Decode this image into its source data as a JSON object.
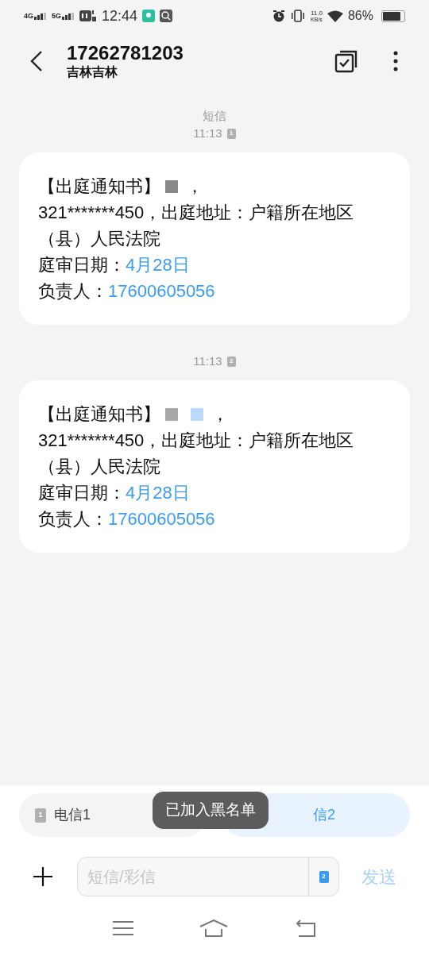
{
  "status_bar": {
    "network_1": "4G",
    "network_2": "5G",
    "time": "12:44",
    "speed": "11.0",
    "speed_unit": "KB/s",
    "battery": "86%"
  },
  "header": {
    "title": "17262781203",
    "subtitle": "吉林吉林"
  },
  "conversation": [
    {
      "kind": "label",
      "text": "短信"
    },
    {
      "kind": "time",
      "text": "11:13",
      "sim": "1"
    },
    {
      "kind": "message",
      "prefix": "【出庭通知书】",
      "redactions": [
        {
          "color": "#888888"
        }
      ],
      "comma": "，",
      "body": "321*******450，出庭地址：户籍所在地区（县）人民法院",
      "lines": [
        {
          "label": "庭审日期：",
          "link": "4月28日"
        },
        {
          "label": "负责人：",
          "link": "17600605056"
        }
      ]
    },
    {
      "kind": "time",
      "text": "11:13",
      "sim": "2"
    },
    {
      "kind": "message",
      "prefix": "【出庭通知书】",
      "redactions": [
        {
          "color": "#a8a8a8"
        },
        {
          "color": "#bcd9fb"
        }
      ],
      "comma": "，",
      "body": "321*******450，出庭地址：户籍所在地区（县）人民法院",
      "lines": [
        {
          "label": "庭审日期：",
          "link": "4月28日"
        },
        {
          "label": "负责人：",
          "link": "17600605056"
        }
      ]
    }
  ],
  "sim_choices": [
    {
      "label": "电信1",
      "sim": "1",
      "selected": false
    },
    {
      "label": "信2",
      "selected": true
    }
  ],
  "toast": "已加入黑名单",
  "composer": {
    "placeholder": "短信/彩信",
    "sim": "2",
    "send": "发送",
    "send_disabled": true
  }
}
